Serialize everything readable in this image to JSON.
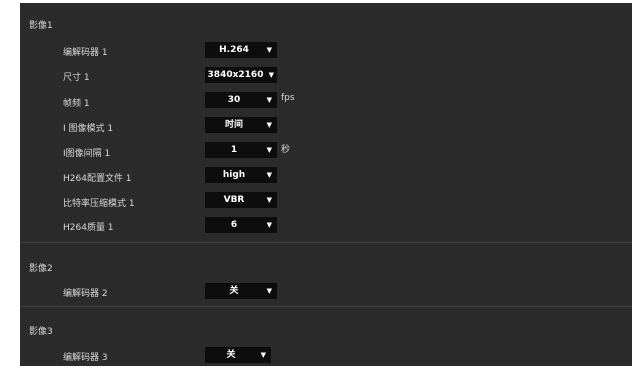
{
  "video1": {
    "title": "影像1",
    "rows": [
      {
        "label": "编解码器 1",
        "value": "H.264"
      },
      {
        "label": "尺寸 1",
        "value": "3840x2160"
      },
      {
        "label": "帧频 1",
        "value": "30",
        "unit": "fps"
      },
      {
        "label": "I 图像模式 1",
        "value": "时间"
      },
      {
        "label": "I图像间隔 1",
        "value": "1",
        "unit": "秒"
      },
      {
        "label": "H264配置文件 1",
        "value": "high"
      },
      {
        "label": "比特率压缩模式 1",
        "value": "VBR"
      },
      {
        "label": "H264质量 1",
        "value": "6"
      }
    ]
  },
  "video2": {
    "title": "影像2",
    "rows": [
      {
        "label": "编解码器 2",
        "value": "关"
      }
    ]
  },
  "video3": {
    "title": "影像3",
    "rows": [
      {
        "label": "编解码器 3",
        "value": "关"
      }
    ]
  },
  "icons": {
    "dropdown_arrow": "▼"
  },
  "colors": {
    "panel_bg": "#2b2b2b",
    "select_bg": "#0d0d0d",
    "text": "#d8d8d8"
  }
}
